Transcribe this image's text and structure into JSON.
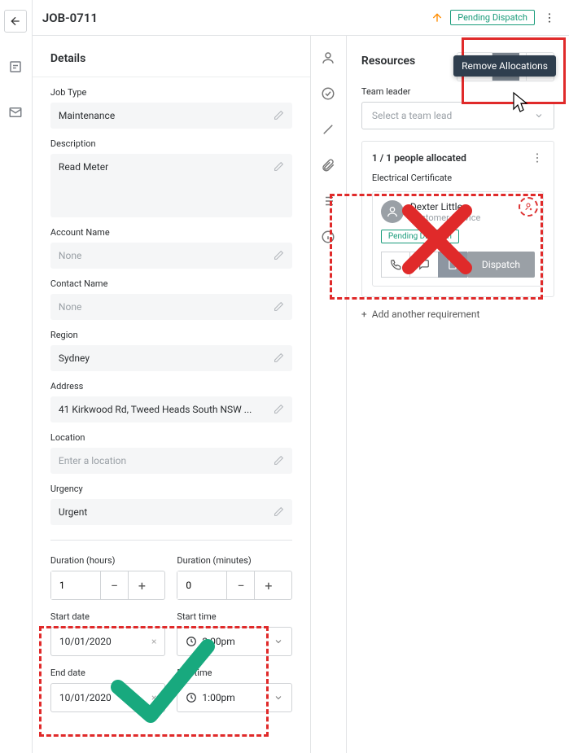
{
  "header": {
    "title": "JOB-0711",
    "status": "Pending Dispatch"
  },
  "tooltip": "Remove Allocations",
  "details": {
    "title": "Details",
    "job_type": {
      "label": "Job Type",
      "value": "Maintenance"
    },
    "description": {
      "label": "Description",
      "value": "Read Meter"
    },
    "account": {
      "label": "Account Name",
      "value": "None"
    },
    "contact": {
      "label": "Contact Name",
      "value": "None"
    },
    "region": {
      "label": "Region",
      "value": "Sydney"
    },
    "address": {
      "label": "Address",
      "value": "41 Kirkwood Rd, Tweed Heads South NSW ..."
    },
    "location": {
      "label": "Location",
      "placeholder": "Enter a location"
    },
    "urgency": {
      "label": "Urgency",
      "value": "Urgent"
    },
    "dur_h": {
      "label": "Duration (hours)",
      "value": "1"
    },
    "dur_m": {
      "label": "Duration (minutes)",
      "value": "0"
    },
    "start_date": {
      "label": "Start date",
      "value": "10/01/2020"
    },
    "start_time": {
      "label": "Start time",
      "value": "2:00pm"
    },
    "end_date": {
      "label": "End date",
      "value": "10/01/2020"
    },
    "end_time": {
      "label": "End time",
      "value": "1:00pm"
    }
  },
  "resources": {
    "title": "Resources",
    "team_leader_label": "Team leader",
    "team_leader_placeholder": "Select a team lead",
    "alloc_count": "1 / 1 people allocated",
    "requirement": "Electrical Certificate",
    "person": {
      "name": "Dexter Little",
      "role": "Customer Service",
      "status": "Pending Dispatch"
    },
    "dispatch": "Dispatch",
    "add_requirement": "Add another requirement"
  }
}
